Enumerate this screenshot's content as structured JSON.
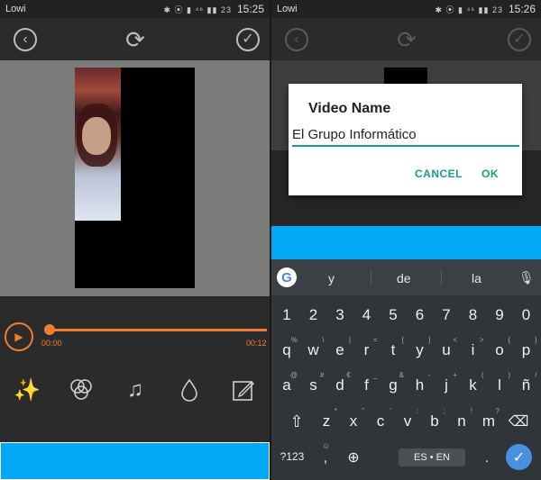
{
  "left": {
    "status": {
      "carrier": "Lowi",
      "icons": "✱ ⦿ ▮ ⁴⁶ ▮▮ 23",
      "time": "15:25"
    },
    "player": {
      "start_time": "00:00",
      "end_time": "00:12",
      "progress": 0
    },
    "tools": [
      "magic-wand",
      "color-filters",
      "music",
      "drop",
      "edit"
    ]
  },
  "right": {
    "status": {
      "carrier": "Lowi",
      "icons": "✱ ⦿ ▮ ⁴⁶ ▮▮ 23",
      "time": "15:26"
    },
    "dialog": {
      "title": "Video Name",
      "value": "El Grupo Informático",
      "cancel_label": "CANCEL",
      "ok_label": "OK"
    },
    "keyboard": {
      "suggestions": [
        "y",
        "de",
        "la"
      ],
      "numbers": [
        "1",
        "2",
        "3",
        "4",
        "5",
        "6",
        "7",
        "8",
        "9",
        "0"
      ],
      "row1": [
        "q",
        "w",
        "e",
        "r",
        "t",
        "y",
        "u",
        "i",
        "o",
        "p"
      ],
      "row1_alt": [
        "%",
        "\\",
        "|",
        "=",
        "[",
        "]",
        "<",
        ">",
        "{",
        "}"
      ],
      "row2": [
        "a",
        "s",
        "d",
        "f",
        "g",
        "h",
        "j",
        "k",
        "l",
        "ñ"
      ],
      "row2_alt": [
        "@",
        "#",
        "€",
        "_",
        "&",
        "-",
        "+",
        "(",
        ")",
        "/"
      ],
      "row3": [
        "z",
        "x",
        "c",
        "v",
        "b",
        "n",
        "m"
      ],
      "row3_alt": [
        "*",
        "\"",
        "'",
        ":",
        ";",
        "!",
        "?"
      ],
      "symbols_label": "?123",
      "comma_alt": "☺",
      "space_label": "ES • EN",
      "period": "."
    }
  },
  "colors": {
    "accent": "#f07d30",
    "blue_bar": "#03a9f4",
    "teal": "#1a9b8c"
  }
}
